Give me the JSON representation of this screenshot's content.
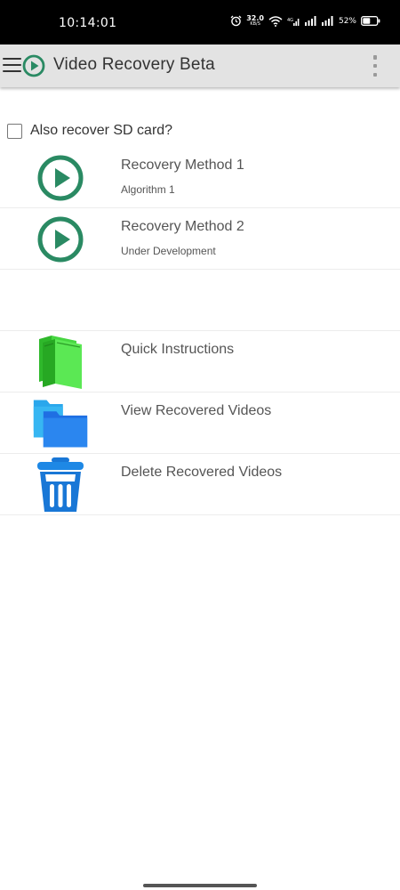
{
  "status_bar": {
    "time": "10:14:01",
    "net_speed_value": "32.0",
    "net_speed_unit": "KB/S",
    "battery_percent": "52%"
  },
  "app_bar": {
    "title": "Video Recovery Beta"
  },
  "sd_option": {
    "label": "Also recover SD card?",
    "checked": false
  },
  "list": {
    "method1": {
      "title": "Recovery Method 1",
      "subtitle": "Algorithm 1",
      "icon": "play-circle-icon"
    },
    "method2": {
      "title": "Recovery Method 2",
      "subtitle": "Under Development",
      "icon": "play-circle-icon"
    },
    "instructions": {
      "title": "Quick Instructions",
      "icon": "books-icon"
    },
    "view": {
      "title": "View Recovered Videos",
      "icon": "folder-icon"
    },
    "delete": {
      "title": "Delete Recovered Videos",
      "icon": "trash-icon"
    }
  },
  "colors": {
    "accent_green": "#2a8a63",
    "app_bar_bg": "#e3e3e3",
    "books_green": "#3fcf3a",
    "folder_blue": "#1e7be8",
    "trash_blue": "#1977d6"
  }
}
